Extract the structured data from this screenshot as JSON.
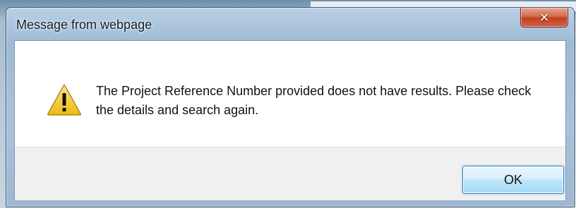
{
  "window": {
    "title": "Message from webpage",
    "close_glyph": "✕"
  },
  "dialog": {
    "icon": "warning-icon",
    "message": "The Project Reference Number provided does not have results. Please check the details and search again.",
    "ok_label": "OK"
  },
  "colors": {
    "accent": "#3c7fb1",
    "close_button": "#c0401f",
    "warning_fill": "#f3c418"
  }
}
